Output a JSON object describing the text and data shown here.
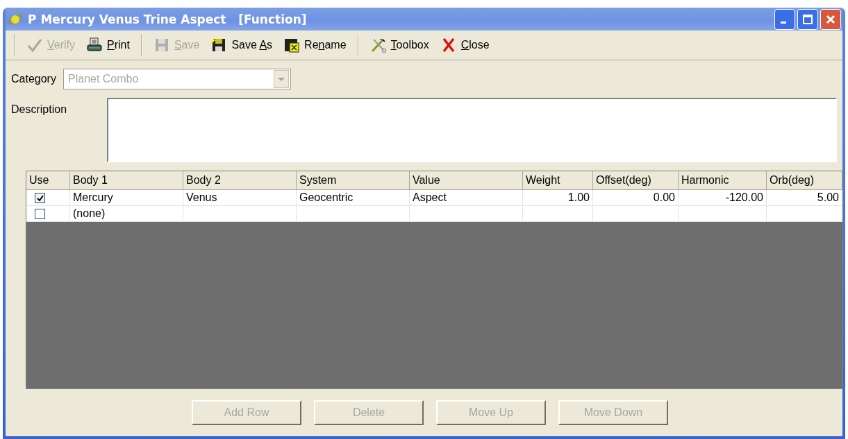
{
  "window": {
    "title": "P Mercury Venus Trine Aspect   [Function]"
  },
  "toolbar": [
    {
      "kind": "separator"
    },
    {
      "kind": "button",
      "key": "V",
      "post": "erify",
      "disabled": true
    },
    {
      "kind": "button",
      "key": "P",
      "post": "rint",
      "disabled": false
    },
    {
      "kind": "separator"
    },
    {
      "kind": "button",
      "key": "S",
      "post": "ave",
      "disabled": true
    },
    {
      "kind": "button",
      "pre": "Save ",
      "key": "A",
      "post": "s",
      "disabled": false
    },
    {
      "kind": "button",
      "pre": "Re",
      "key": "n",
      "post": "ame",
      "disabled": false
    },
    {
      "kind": "separator"
    },
    {
      "kind": "button",
      "key": "T",
      "post": "oolbox",
      "disabled": false
    },
    {
      "kind": "button",
      "key": "C",
      "post": "lose",
      "disabled": false
    }
  ],
  "category": {
    "label": "Category",
    "value": "Planet Combo",
    "disabled": true
  },
  "description": {
    "label": "Description"
  },
  "table": {
    "columns": [
      "Use",
      "Body 1",
      "Body 2",
      "System",
      "Value",
      "Weight",
      "Offset(deg)",
      "Harmonic",
      "Orb(deg)"
    ],
    "rows": [
      {
        "checked": true,
        "cells": [
          "",
          "Mercury",
          "Venus",
          "Geocentric",
          "Aspect",
          "1.00",
          "0.00",
          "-120.00",
          "5.00"
        ]
      },
      {
        "checked": false,
        "cells": [
          "",
          "(none)",
          "",
          "",
          "",
          "",
          "",
          "",
          ""
        ]
      }
    ]
  },
  "buttons": [
    {
      "label": "Add Row",
      "disabled": true
    },
    {
      "label": "Delete",
      "disabled": true
    },
    {
      "label": "Move Up",
      "disabled": true
    },
    {
      "label": "Move Down",
      "disabled": true
    }
  ]
}
